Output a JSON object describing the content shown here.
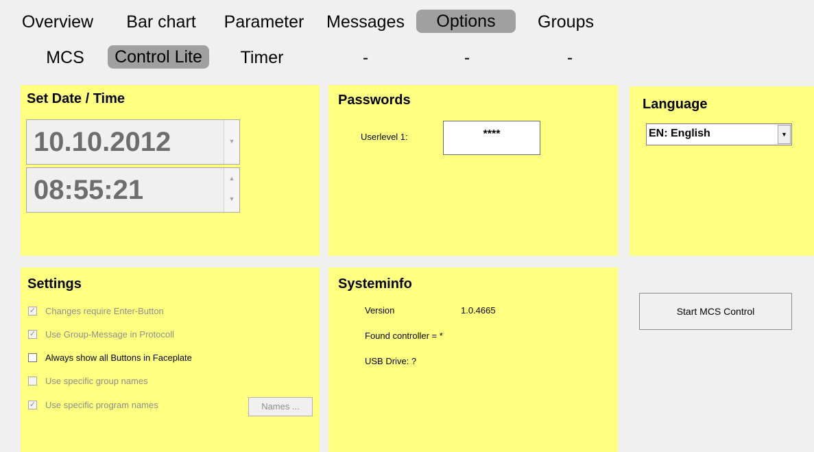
{
  "tabs_row1": [
    "Overview",
    "Bar chart",
    "Parameter",
    "Messages",
    "Options",
    "Groups"
  ],
  "tabs_row2": [
    "MCS",
    "Control Lite",
    "Timer",
    "-",
    "-",
    "-"
  ],
  "active_tab_row1": "Options",
  "active_tab_row2": "Control Lite",
  "datetime": {
    "title": "Set Date / Time",
    "date": "10.10.2012",
    "time": "08:55:21"
  },
  "passwords": {
    "title": "Passwords",
    "userlevel_label": "Userlevel 1:",
    "userlevel_value": "****"
  },
  "language": {
    "title": "Language",
    "selected": "EN: English"
  },
  "settings": {
    "title": "Settings",
    "options": [
      {
        "label": "Changes require Enter-Button",
        "checked": true,
        "enabled": false
      },
      {
        "label": "Use Group-Message in Protocoll",
        "checked": true,
        "enabled": false
      },
      {
        "label": "Always show all Buttons in Faceplate",
        "checked": false,
        "enabled": true
      },
      {
        "label": "Use specific group names",
        "checked": false,
        "enabled": false
      },
      {
        "label": "Use specific program names",
        "checked": true,
        "enabled": false
      }
    ],
    "names_button": "Names ..."
  },
  "systeminfo": {
    "title": "Systeminfo",
    "version_label": "Version",
    "version_value": "1.0.4665",
    "controller": "Found controller = *",
    "usb": "USB Drive: ?"
  },
  "start_button": "Start MCS Control",
  "colors": {
    "panel": "#ffff80",
    "background": "#f0f0f0",
    "active_tab": "#a0a0a0"
  }
}
